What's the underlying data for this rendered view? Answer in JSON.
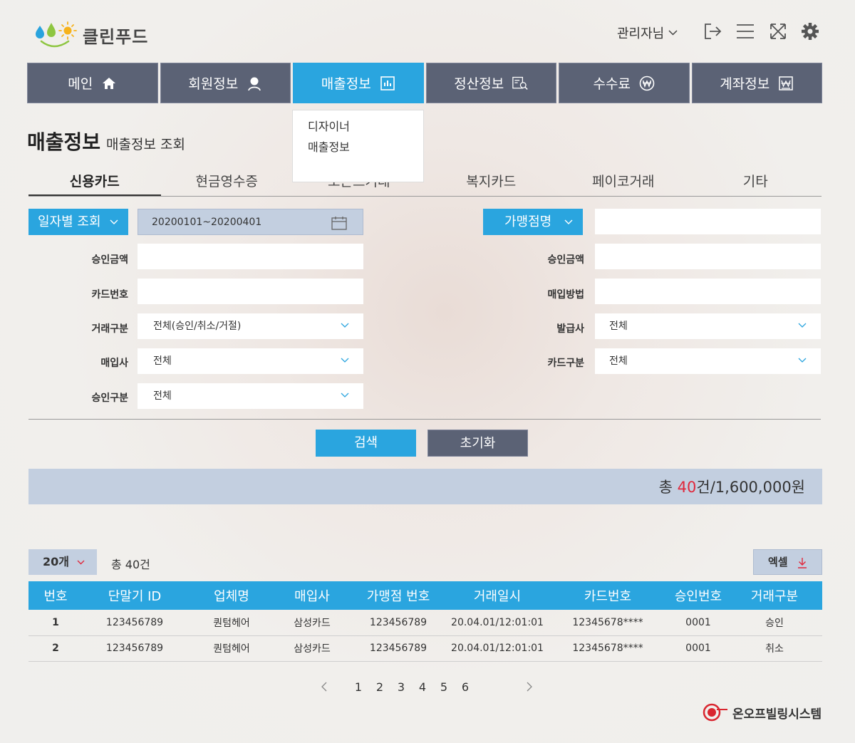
{
  "app": {
    "logo_text": "클린푸드"
  },
  "header": {
    "admin_label": "관리자님"
  },
  "nav": [
    {
      "label": "메인",
      "icon": "home-icon"
    },
    {
      "label": "회원정보",
      "icon": "user-icon"
    },
    {
      "label": "매출정보",
      "icon": "bar-chart-icon"
    },
    {
      "label": "정산정보",
      "icon": "invoice-search-icon"
    },
    {
      "label": "수수료",
      "icon": "won-circle-icon"
    },
    {
      "label": "계좌정보",
      "icon": "account-book-icon"
    }
  ],
  "dropdown": {
    "items": [
      "디자이너",
      "매출정보"
    ]
  },
  "page": {
    "title": "매출정보",
    "subtitle": "매출정보 조회"
  },
  "tabs": [
    "신용카드",
    "현금영수증",
    "오픈트거래",
    "복지카드",
    "페이코거래",
    "기타"
  ],
  "form": {
    "date_select": "일자별 조회",
    "date_range": "20200101~20200401",
    "merchant_select": "가맹점명",
    "approval_amount": "승인금액",
    "card_number": "카드번호",
    "trade_type": "거래구분",
    "trade_type_value": "전체(승인/취소/거절)",
    "acquirer": "매입사",
    "acquirer_value": "전체",
    "approval_type": "승인구분",
    "approval_type_value": "전체",
    "approval_amount_r": "승인금액",
    "purchase_method": "매입방법",
    "issuer": "발급사",
    "issuer_value": "전체",
    "card_type": "카드구분",
    "card_type_value": "전체"
  },
  "buttons": {
    "search": "검색",
    "reset": "초기화"
  },
  "summary": {
    "prefix": "총 ",
    "count": "40",
    "suffix": "건/1,600,000원"
  },
  "list": {
    "page_size": "20개",
    "total": "총 40건",
    "excel": "엑셀"
  },
  "table": {
    "headers": [
      "번호",
      "단말기 ID",
      "업체명",
      "매입사",
      "가맹점 번호",
      "거래일시",
      "카드번호",
      "승인번호",
      "거래구분"
    ],
    "rows": [
      [
        "1",
        "123456789",
        "퀀텀헤어",
        "삼성카드",
        "123456789",
        "20.04.01/12:01:01",
        "12345678****",
        "0001",
        "승인"
      ],
      [
        "2",
        "123456789",
        "퀀텀헤어",
        "삼성카드",
        "123456789",
        "20.04.01/12:01:01",
        "12345678****",
        "0001",
        "취소"
      ]
    ]
  },
  "pagination": {
    "pages": [
      "1",
      "2",
      "3",
      "4",
      "5",
      "6"
    ]
  },
  "footer": {
    "company": "온오프빌링시스템"
  },
  "colors": {
    "accent": "#2aa5df",
    "nav": "#5b6275",
    "highlight": "#e0283c",
    "panel": "#c3cfe0"
  }
}
